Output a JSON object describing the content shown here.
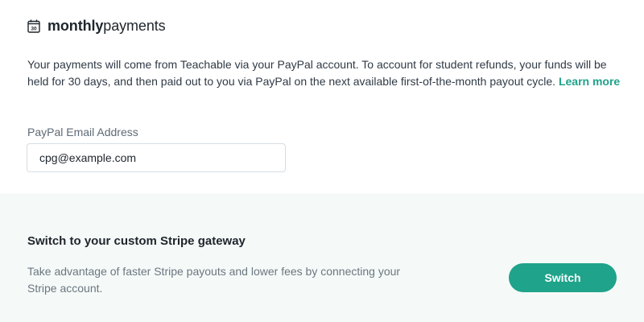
{
  "header": {
    "icon": "calendar-icon",
    "icon_number": "30",
    "title_bold": "monthly",
    "title_light": "payments"
  },
  "description": {
    "text": "Your payments will come from Teachable via your PayPal account. To account for student refunds, your funds will be held for 30 days, and then paid out to you via PayPal on the next available first-of-the-month payout cycle. ",
    "link_label": "Learn more"
  },
  "paypal_field": {
    "label": "PayPal Email Address",
    "value": "cpg@example.com"
  },
  "stripe_section": {
    "heading": "Switch to your custom Stripe gateway",
    "description": "Take advantage of faster Stripe payouts and lower fees by connecting your Stripe account.",
    "button_label": "Switch"
  },
  "colors": {
    "accent": "#1fa38a",
    "section_bg": "#f5faf8",
    "text": "#2f3a45"
  }
}
